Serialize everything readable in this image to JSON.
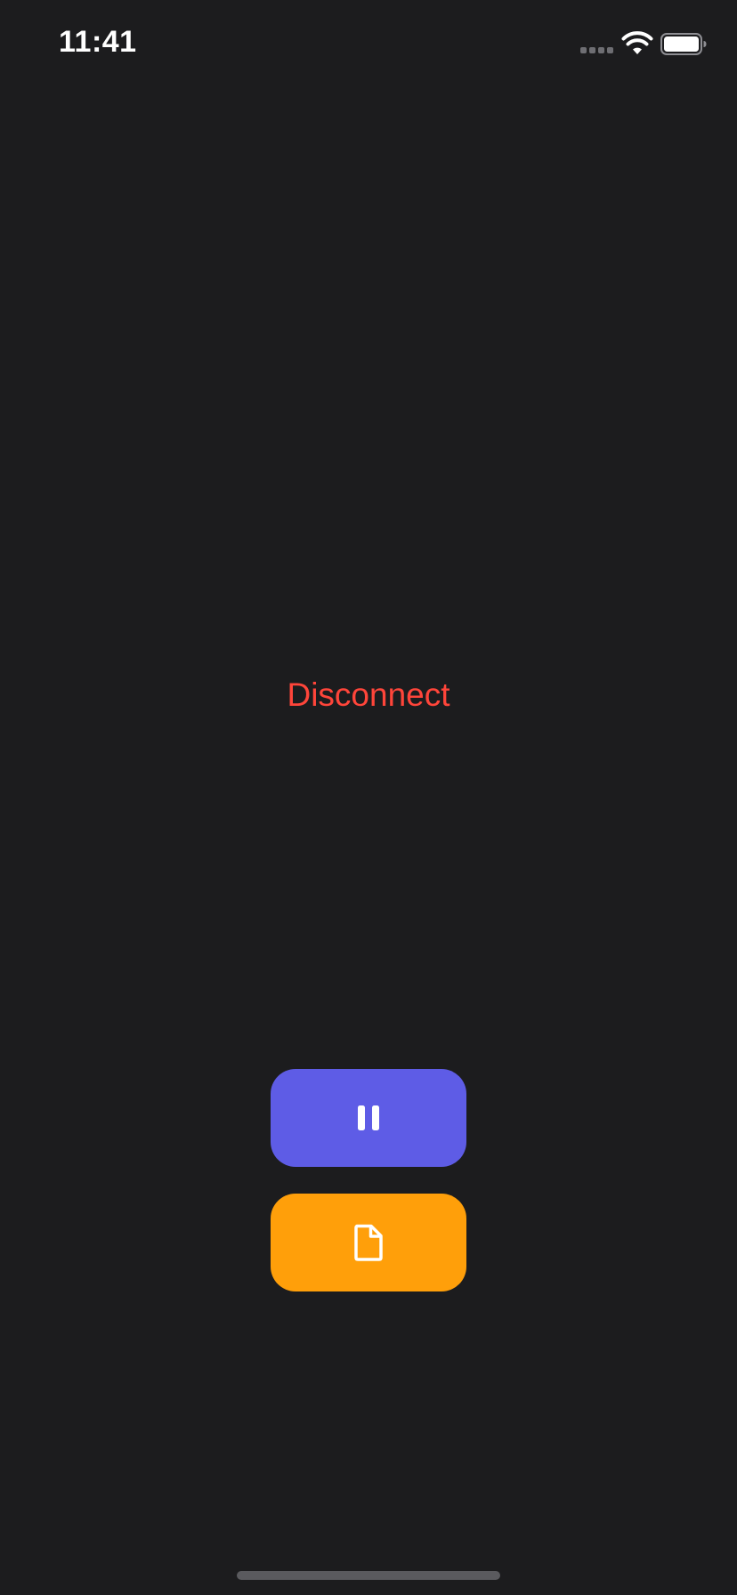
{
  "status_bar": {
    "time": "11:41",
    "signal_icon": "cellular-signal-icon",
    "wifi_icon": "wifi-icon",
    "battery_icon": "battery-full-icon"
  },
  "main": {
    "disconnect_label": "Disconnect",
    "pause_button_icon": "pause-icon",
    "file_button_icon": "document-icon"
  },
  "colors": {
    "background": "#1c1c1e",
    "disconnect_text": "#ff453a",
    "pause_button": "#5e5ce6",
    "file_button": "#ff9f0a",
    "icon": "#ffffff"
  }
}
